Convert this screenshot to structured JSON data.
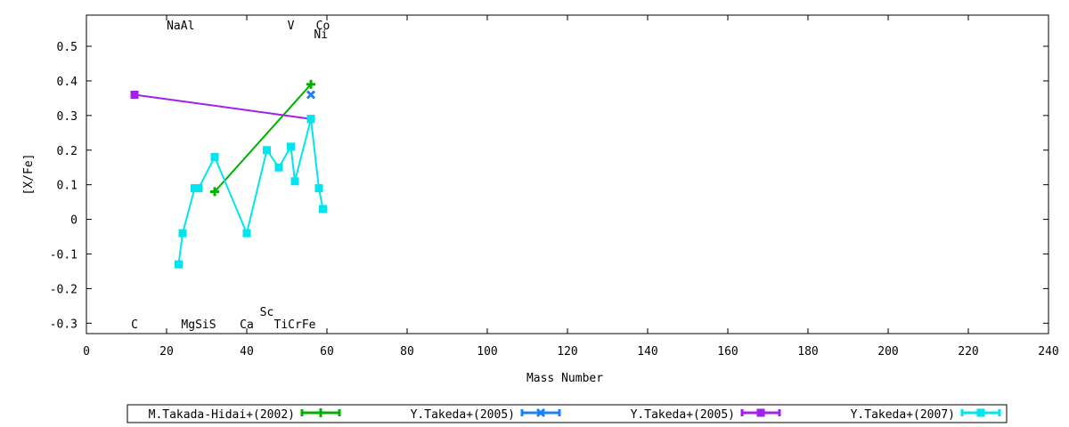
{
  "chart_data": {
    "type": "line",
    "xlabel": "Mass Number",
    "ylabel": "[X/Fe]",
    "xlim": [
      0,
      240
    ],
    "ylim": [
      -0.33,
      0.59
    ],
    "xticks": [
      0,
      20,
      40,
      60,
      80,
      100,
      120,
      140,
      160,
      180,
      200,
      220,
      240
    ],
    "yticks": [
      -0.3,
      -0.2,
      -0.1,
      0,
      0.1,
      0.2,
      0.3,
      0.4,
      0.5
    ],
    "ytick_labels": [
      "-0.3",
      "-0.2",
      "-0.1",
      "0",
      "0.1",
      "0.2",
      "0.3",
      "0.4",
      "0.5"
    ],
    "grid": false,
    "legend_position": "bottom",
    "element_labels": [
      {
        "text": "NaAl",
        "x": 23.5,
        "row": "top"
      },
      {
        "text": "V",
        "x": 51,
        "row": "top"
      },
      {
        "text": "Co",
        "x": 59,
        "row": "top"
      },
      {
        "text": "Ni",
        "x": 58.5,
        "row": "top2"
      },
      {
        "text": "C",
        "x": 12,
        "row": "bottom"
      },
      {
        "text": "MgSiS",
        "x": 28,
        "row": "bottom"
      },
      {
        "text": "Ca",
        "x": 40,
        "row": "bottom"
      },
      {
        "text": "Sc",
        "x": 45,
        "row": "bottom2"
      },
      {
        "text": "TiCrFe",
        "x": 52,
        "row": "bottom"
      }
    ],
    "series": [
      {
        "name": "M.Takada-Hidai+(2002)",
        "color": "#00b000",
        "marker": "plus",
        "x": [
          32,
          56
        ],
        "y": [
          0.08,
          0.39
        ]
      },
      {
        "name": "Y.Takeda+(2005)",
        "color": "#1e7fff",
        "marker": "x",
        "x": [
          56
        ],
        "y": [
          0.36
        ]
      },
      {
        "name": "Y.Takeda+(2005)",
        "color": "#a020f0",
        "marker": "square",
        "x": [
          12,
          56
        ],
        "y": [
          0.36,
          0.29
        ]
      },
      {
        "name": "Y.Takeda+(2007)",
        "color": "#00e5ee",
        "marker": "square",
        "x": [
          23,
          24,
          27,
          28,
          32,
          40,
          45,
          48,
          51,
          52,
          56,
          58,
          59
        ],
        "y": [
          -0.13,
          -0.04,
          0.09,
          0.09,
          0.18,
          -0.04,
          0.2,
          0.15,
          0.21,
          0.11,
          0.29,
          0.09,
          0.03
        ]
      }
    ]
  }
}
